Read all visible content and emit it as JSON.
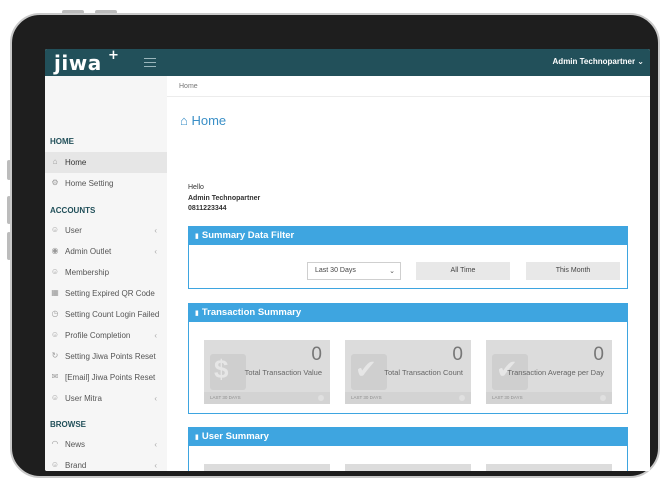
{
  "app": {
    "logo_text": "jiwa",
    "logo_plus": "+",
    "user_name": "Admin Technopartner",
    "user_chevron": "⌄"
  },
  "breadcrumb": "Home",
  "page_title": "Home",
  "greeting": {
    "hello": "Hello",
    "name": "Admin Technopartner",
    "phone": "0811223344"
  },
  "sidebar": {
    "home_header": "HOME",
    "home_items": [
      {
        "label": "Home",
        "icon": "home-icon",
        "glyph": "⌂",
        "active": true
      },
      {
        "label": "Home Setting",
        "icon": "gear-icon",
        "glyph": "⚙"
      }
    ],
    "accounts_header": "ACCOUNTS",
    "accounts_items": [
      {
        "label": "User",
        "icon": "users-icon",
        "glyph": "☺",
        "chevron": "‹"
      },
      {
        "label": "Admin Outlet",
        "icon": "eye-icon",
        "glyph": "◉",
        "chevron": "‹"
      },
      {
        "label": "Membership",
        "icon": "user-icon",
        "glyph": "☺"
      },
      {
        "label": "Setting Expired QR Code",
        "icon": "qr-icon",
        "glyph": "▦"
      },
      {
        "label": "Setting Count Login Failed",
        "icon": "timer-icon",
        "glyph": "◷"
      },
      {
        "label": "Profile Completion",
        "icon": "users-icon",
        "glyph": "☺",
        "chevron": "‹"
      },
      {
        "label": "Setting Jiwa Points Reset",
        "icon": "refresh-icon",
        "glyph": "↻"
      },
      {
        "label": "[Email] Jiwa Points Reset",
        "icon": "envelope-icon",
        "glyph": "✉"
      },
      {
        "label": "User Mitra",
        "icon": "user-gear-icon",
        "glyph": "☺",
        "chevron": "‹"
      }
    ],
    "browse_header": "BROWSE",
    "browse_items": [
      {
        "label": "News",
        "icon": "rss-icon",
        "glyph": "◠",
        "chevron": "‹"
      },
      {
        "label": "Brand",
        "icon": "user-icon",
        "glyph": "☺",
        "chevron": "‹"
      }
    ]
  },
  "panels": {
    "filter_title": "Summary Data Filter",
    "filter_select": "Last 30 Days",
    "filter_select_chevron": "⌄",
    "btn_all_time": "All Time",
    "btn_this_month": "This Month",
    "transaction_title": "Transaction Summary",
    "user_title": "User Summary",
    "stats": [
      {
        "value": "0",
        "caption": "Total Transaction Value",
        "footer": "LAST 30 DAYS",
        "icon": "money-icon",
        "glyph": "$"
      },
      {
        "value": "0",
        "caption": "Total Transaction Count",
        "footer": "LAST 30 DAYS",
        "icon": "check-icon",
        "glyph": "✔"
      },
      {
        "value": "0",
        "caption": "Transaction Average per Day",
        "footer": "LAST 30 DAYS",
        "icon": "check-icon",
        "glyph": "✔"
      }
    ]
  },
  "colors": {
    "topbar": "#22505a",
    "panel_header": "#3ea5e0",
    "title_blue": "#3a8fc7"
  }
}
